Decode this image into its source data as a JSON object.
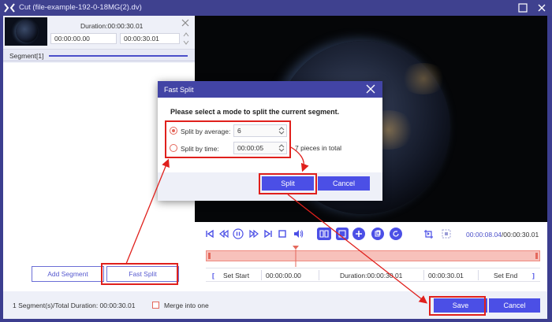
{
  "window": {
    "title": "Cut (file-example-192-0-18MG(2).dv)"
  },
  "segment": {
    "duration_label": "Duration:00:00:30.01",
    "start_time": "00:00:00.00",
    "end_time": "00:00:30.01",
    "tab_label": "Segment[1]"
  },
  "left_buttons": {
    "add_segment": "Add Segment",
    "fast_split": "Fast Split"
  },
  "playback": {
    "current_time": "00:00:08.04",
    "total_time": "/00:00:30.01",
    "playhead_fraction": 0.268
  },
  "set_row": {
    "set_start": "Set Start",
    "start_value": "00:00:00.00",
    "duration_label": "Duration:00:00:30.01",
    "end_value": "00:00:30.01",
    "set_end": "Set End"
  },
  "bottom": {
    "summary": "1 Segment(s)/Total Duration: 00:00:30.01",
    "merge_label": "Merge into one",
    "save": "Save",
    "cancel": "Cancel"
  },
  "dialog": {
    "title": "Fast Split",
    "prompt": "Please select a mode to split the current segment.",
    "option_average_label": "Split by average:",
    "option_average_value": "6",
    "option_time_label": "Split by time:",
    "option_time_value": "00:00:05",
    "pieces_text": "7 pieces in total",
    "split": "Split",
    "cancel": "Cancel"
  },
  "colors": {
    "accent": "#4b4fe6",
    "annotation": "#e0201c",
    "titlebar": "#3f418f",
    "dialog_header": "#4244a5"
  },
  "icons": [
    "app-logo-icon",
    "minimize-icon",
    "close-icon",
    "skip-start-icon",
    "step-back-icon",
    "pause-icon",
    "step-forward-icon",
    "skip-end-icon",
    "stop-icon",
    "volume-icon",
    "split-view-icon",
    "fast-split-icon",
    "add-icon",
    "copy-icon",
    "reset-icon",
    "crop-icon",
    "fullscreen-icon"
  ]
}
